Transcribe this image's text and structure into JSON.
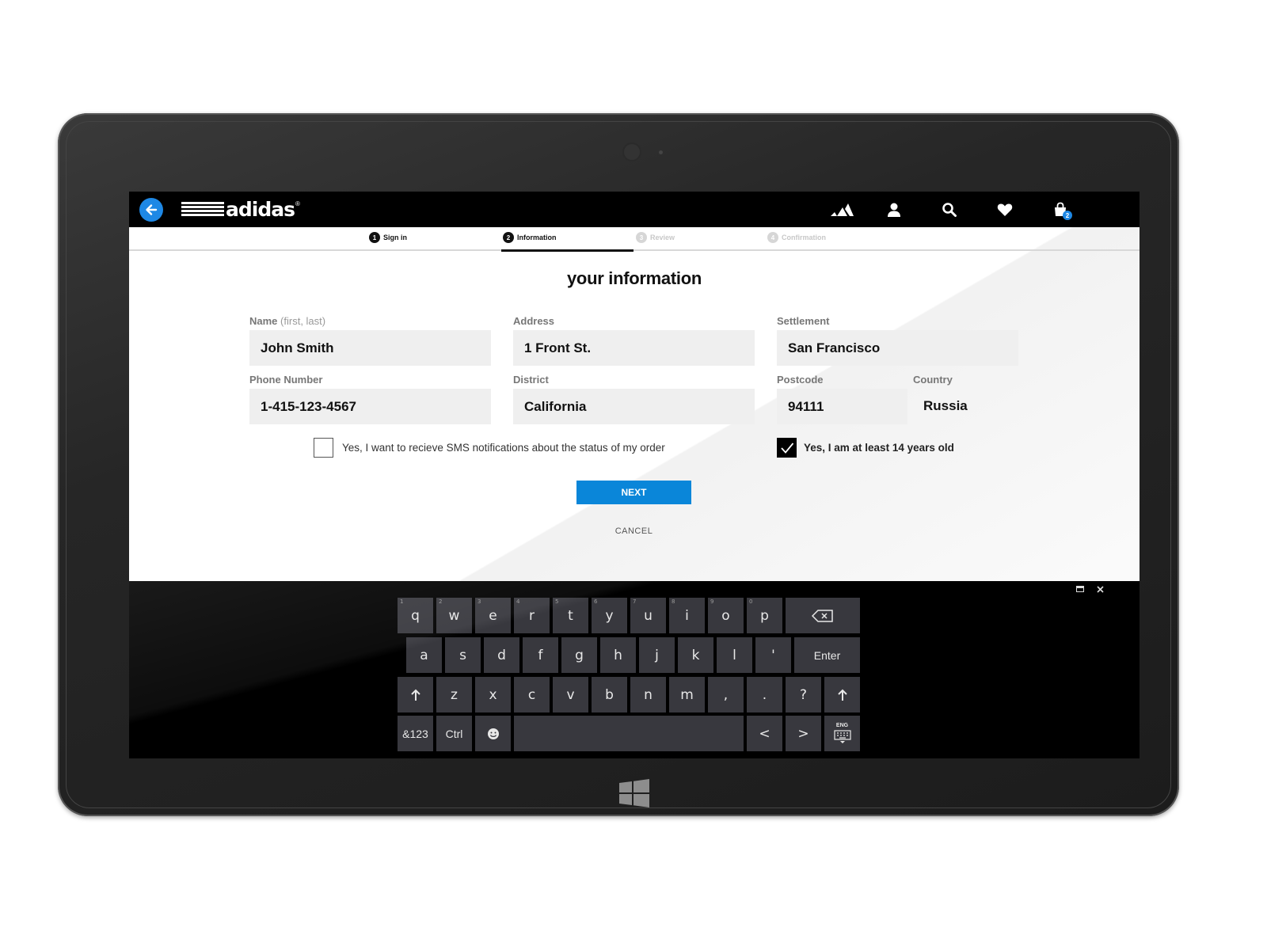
{
  "header": {
    "logo_text": "adidas",
    "logo_reg": "®",
    "cart_count": "2",
    "icons": [
      "back-arrow-icon",
      "adidas-performance-logo-icon",
      "account-icon",
      "search-icon",
      "heart-icon",
      "cart-icon"
    ]
  },
  "steps": [
    {
      "num": "1",
      "label": "Sign in",
      "state": "done"
    },
    {
      "num": "2",
      "label": "Information",
      "state": "active"
    },
    {
      "num": "3",
      "label": "Review",
      "state": "inactive"
    },
    {
      "num": "4",
      "label": "Confirmation",
      "state": "inactive"
    }
  ],
  "form": {
    "title": "your information",
    "name": {
      "label": "Name",
      "hint": "(first, last)",
      "value": "John Smith"
    },
    "address": {
      "label": "Address",
      "value": "1 Front St."
    },
    "settlement": {
      "label": "Settlement",
      "value": "San Francisco"
    },
    "phone": {
      "label": "Phone Number",
      "value": "1-415-123-4567"
    },
    "district": {
      "label": "District",
      "value": "California"
    },
    "postcode": {
      "label": "Postcode",
      "value": "94111"
    },
    "country": {
      "label": "Country",
      "value": "Russia"
    },
    "sms_checkbox": {
      "label": "Yes, I want to recieve SMS notifications about the status of my order",
      "checked": false
    },
    "age_checkbox": {
      "label": "Yes, I am at least 14 years old",
      "checked": true
    },
    "next_label": "NEXT",
    "cancel_label": "CANCEL"
  },
  "keyboard": {
    "row1": [
      "q",
      "w",
      "e",
      "r",
      "t",
      "y",
      "u",
      "i",
      "o",
      "p"
    ],
    "row1_hints": [
      "1",
      "2",
      "3",
      "4",
      "5",
      "6",
      "7",
      "8",
      "9",
      "0"
    ],
    "row2": [
      "a",
      "s",
      "d",
      "f",
      "g",
      "h",
      "j",
      "k",
      "l",
      "'"
    ],
    "enter_label": "Enter",
    "row3": [
      "z",
      "x",
      "c",
      "v",
      "b",
      "n",
      "m",
      ",",
      ".",
      "?"
    ],
    "symbols_label": "&123",
    "ctrl_label": "Ctrl",
    "lang_label": "ENG",
    "left_arrow": "<",
    "right_arrow": ">"
  },
  "accent_color": "#0a86d9",
  "back_button_color": "#1e88e5"
}
